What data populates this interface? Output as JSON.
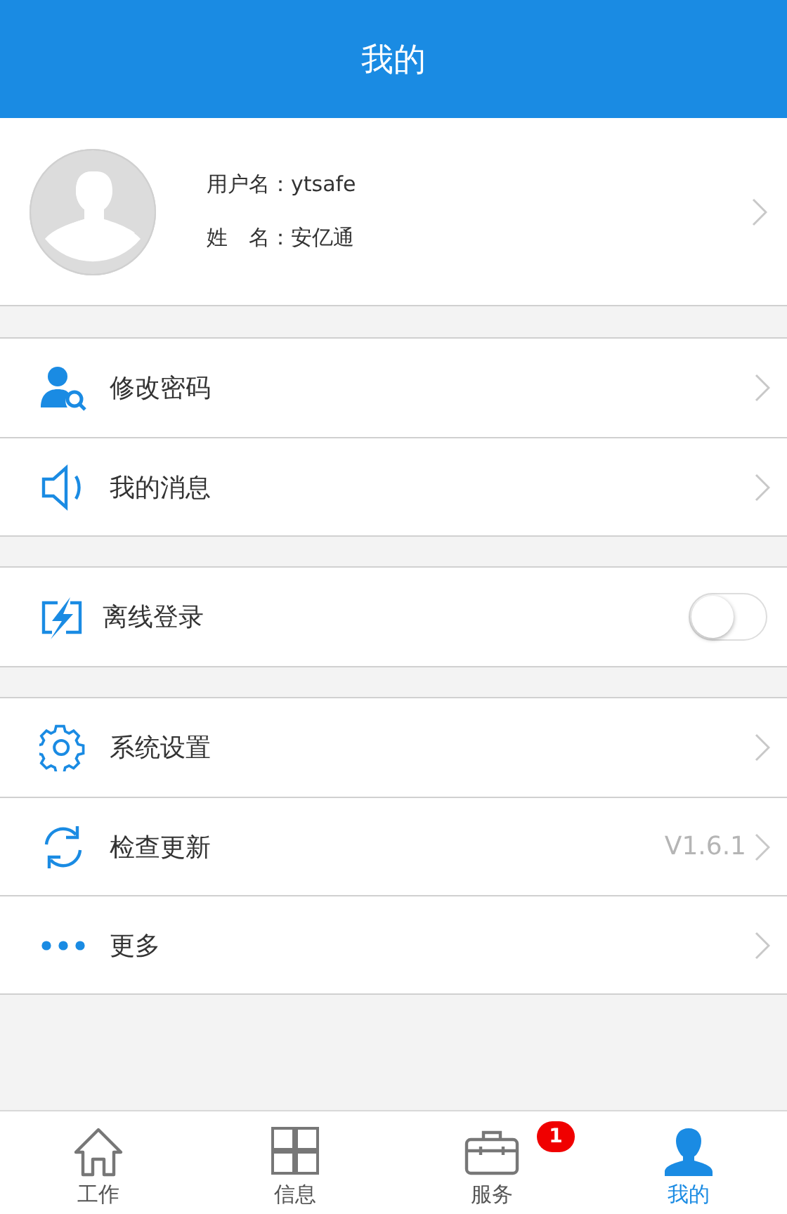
{
  "header": {
    "title": "我的"
  },
  "profile": {
    "username_label": "用户名：",
    "username": "ytsafe",
    "name_label": "姓　名：",
    "name": "安亿通"
  },
  "groups": [
    {
      "rows": [
        {
          "kind": "link",
          "label": "修改密码"
        },
        {
          "kind": "link",
          "label": "我的消息"
        }
      ]
    },
    {
      "rows": [
        {
          "kind": "toggle",
          "label": "离线登录",
          "on": false
        }
      ]
    },
    {
      "rows": [
        {
          "kind": "link",
          "label": "系统设置"
        },
        {
          "kind": "link",
          "label": "检查更新",
          "value": "V1.6.1"
        },
        {
          "kind": "link",
          "label": "更多"
        }
      ]
    }
  ],
  "tab_bar": [
    {
      "label": "工作",
      "selected": false
    },
    {
      "label": "信息",
      "selected": false
    },
    {
      "label": "服务",
      "selected": false,
      "badge": "1"
    },
    {
      "label": "我的",
      "selected": true
    }
  ]
}
